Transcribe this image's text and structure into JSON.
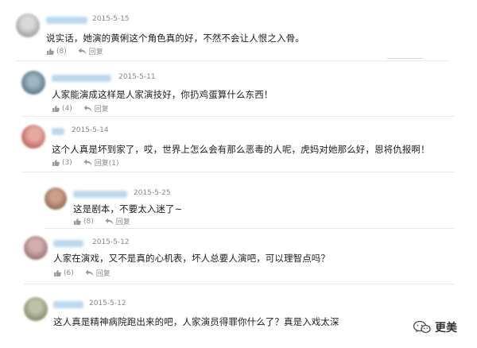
{
  "comments": [
    {
      "date": "2015-5-15",
      "text": "说实话，她演的黄俐这个角色真的好，不然不会让人恨之入骨。",
      "like_count": "(8)",
      "reply_label": "回复",
      "avatar_color": "#a6a6a6"
    },
    {
      "date": "2015-5-11",
      "text": "人家能演成这样是人家演技好，你扔鸡蛋算什么东西！",
      "like_count": "(4)",
      "reply_label": "回复",
      "avatar_color": "#5f7e8f"
    },
    {
      "date": "2015-5-14",
      "text": "这个人真是坏到家了，哎，世界上怎么会有那么恶毒的人呢，虎妈对她那么好，恩将仇报啊！",
      "like_count": "(3)",
      "reply_label": "回复(1)",
      "avatar_color": "#c06a6a"
    },
    {
      "date": "2015-5-25",
      "text": "这是剧本，不要太入迷了~",
      "like_count": "(8)",
      "reply_label": "回复",
      "avatar_color": "#9b6e5a"
    },
    {
      "date": "2015-5-12",
      "text": "人家在演戏，又不是真的心机表，坏人总要人演吧，可以理智点吗？",
      "like_count": "(6)",
      "reply_label": "回复",
      "avatar_color": "#a07878"
    },
    {
      "date": "2015-5-12",
      "text": "这人真是精神病院跑出来的吧，人家演员得罪你什么了？真是入戏太深",
      "like_count": "",
      "reply_label": "",
      "avatar_color": "#8a8f72"
    }
  ],
  "watermark": {
    "label": "更美"
  },
  "colors": {
    "background": "#ffffff",
    "date_text": "#888888",
    "action_text": "#8a8a8a",
    "name_blur": "#bcd7ee"
  }
}
